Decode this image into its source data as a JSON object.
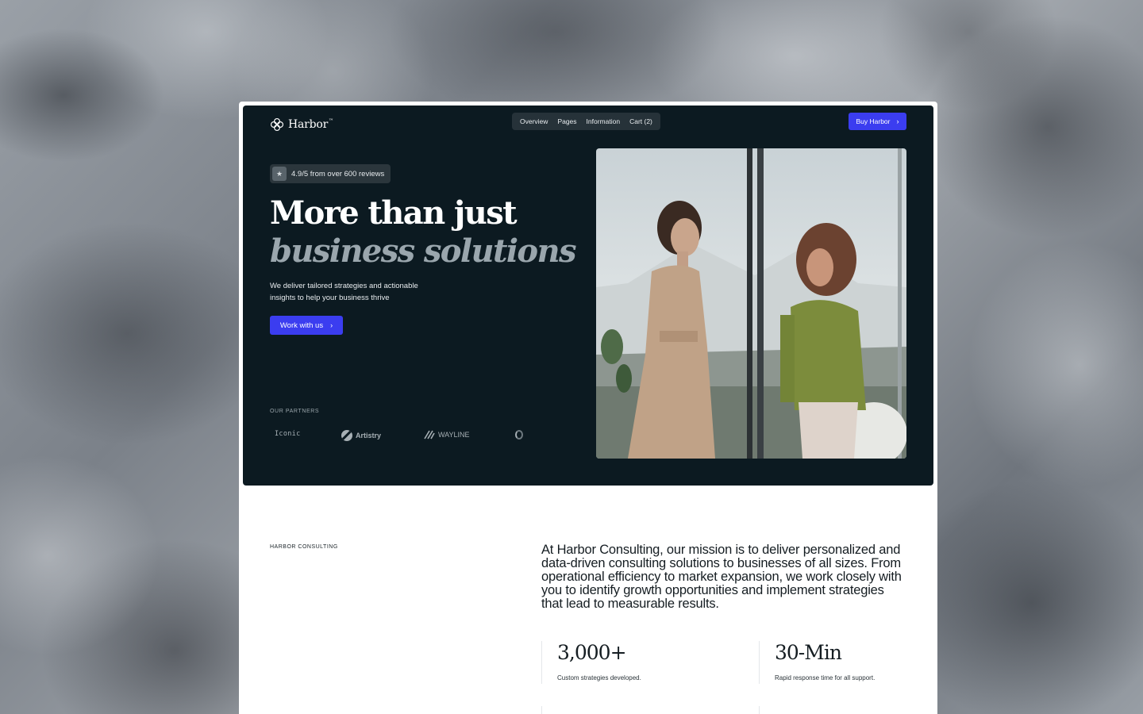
{
  "brand": {
    "name": "Harbor",
    "trademark": "™"
  },
  "nav": {
    "items": [
      {
        "label": "Overview"
      },
      {
        "label": "Pages"
      },
      {
        "label": "Information"
      },
      {
        "label": "Cart (2)"
      }
    ],
    "buy_label": "Buy Harbor"
  },
  "hero": {
    "rating_text": "4.9/5 from over 600 reviews",
    "headline_line1": "More than just",
    "headline_line2": "business solutions",
    "subtext": "We deliver tailored strategies and actionable insights to help your business thrive",
    "cta_label": "Work with us",
    "partners_label": "OUR PARTNERS",
    "partners": [
      {
        "name": "Iconic",
        "icon": "none"
      },
      {
        "name": "Artistry",
        "icon": "slashed-disc-icon"
      },
      {
        "name": "WAYLINE",
        "icon": "slash-lines-icon"
      },
      {
        "name": "",
        "icon": "half-disc-icon"
      }
    ]
  },
  "about": {
    "label": "HARBOR CONSULTING",
    "mission": "At Harbor Consulting, our mission is to deliver personalized and data-driven consulting solutions to businesses of all sizes. From operational efficiency to market expansion, we work closely with you to identify growth opportunities and implement strategies that lead to measurable results.",
    "stats": [
      {
        "value": "3,000+",
        "caption": "Custom strategies developed."
      },
      {
        "value": "30-Min",
        "caption": "Rapid response time for all support."
      }
    ]
  },
  "colors": {
    "accent": "#3b3df0",
    "hero_bg": "#0c1a21",
    "nav_bg": "#263239"
  }
}
